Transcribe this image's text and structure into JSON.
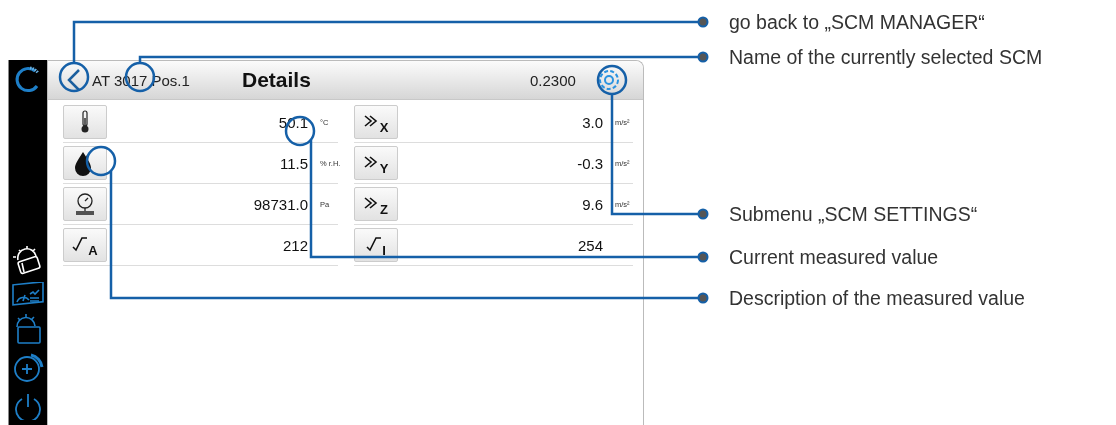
{
  "header": {
    "device_name": "AT 3017 Pos.1",
    "title": "Details",
    "value": "0.2300"
  },
  "measurements": [
    {
      "kind": "temperature",
      "value": "50.1",
      "unit": "°C"
    },
    {
      "kind": "acceleration",
      "letter": "X",
      "value": "3.0",
      "unit": "m/s²"
    },
    {
      "kind": "humidity",
      "value": "11.5",
      "unit": "% r.H."
    },
    {
      "kind": "acceleration",
      "letter": "Y",
      "value": "-0.3",
      "unit": "m/s²"
    },
    {
      "kind": "pressure",
      "value": "98731.0",
      "unit": "Pa"
    },
    {
      "kind": "acceleration",
      "letter": "Z",
      "value": "9.6",
      "unit": "m/s²"
    },
    {
      "kind": "check",
      "letter": "A",
      "value": "212"
    },
    {
      "kind": "check",
      "letter": "I",
      "value": "254"
    }
  ],
  "annotations": [
    "go back to „SCM MANAGER“",
    "Name of the currently selected SCM",
    "Submenu „SCM SETTINGS“",
    "Current measured value",
    "Description of the measured value"
  ]
}
